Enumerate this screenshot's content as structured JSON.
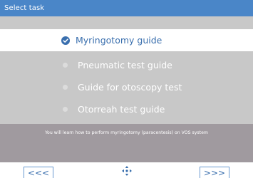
{
  "header": {
    "title": "Select task"
  },
  "tasks": [
    {
      "label": "Myringotomy guide",
      "state": "selected",
      "icon": "check-circle-icon"
    },
    {
      "label": "Pneumatic test guide",
      "state": "normal",
      "icon": "bullet-icon"
    },
    {
      "label": "Guide for otoscopy test",
      "state": "normal",
      "icon": "bullet-icon"
    },
    {
      "label": "Otorreah test guide",
      "state": "normal",
      "icon": "bullet-icon"
    }
  ],
  "description": "You will learn how to perform myringotomy (paracentesis) on VOS system",
  "navigation": {
    "prev_label": "<<<",
    "next_label": ">>>",
    "center_icon": "move-arrows-icon"
  },
  "colors": {
    "accent": "#4a86c8",
    "selected_text": "#3a6fae",
    "list_bg": "#c8c8c8",
    "description_bg": "#a09a9f"
  }
}
